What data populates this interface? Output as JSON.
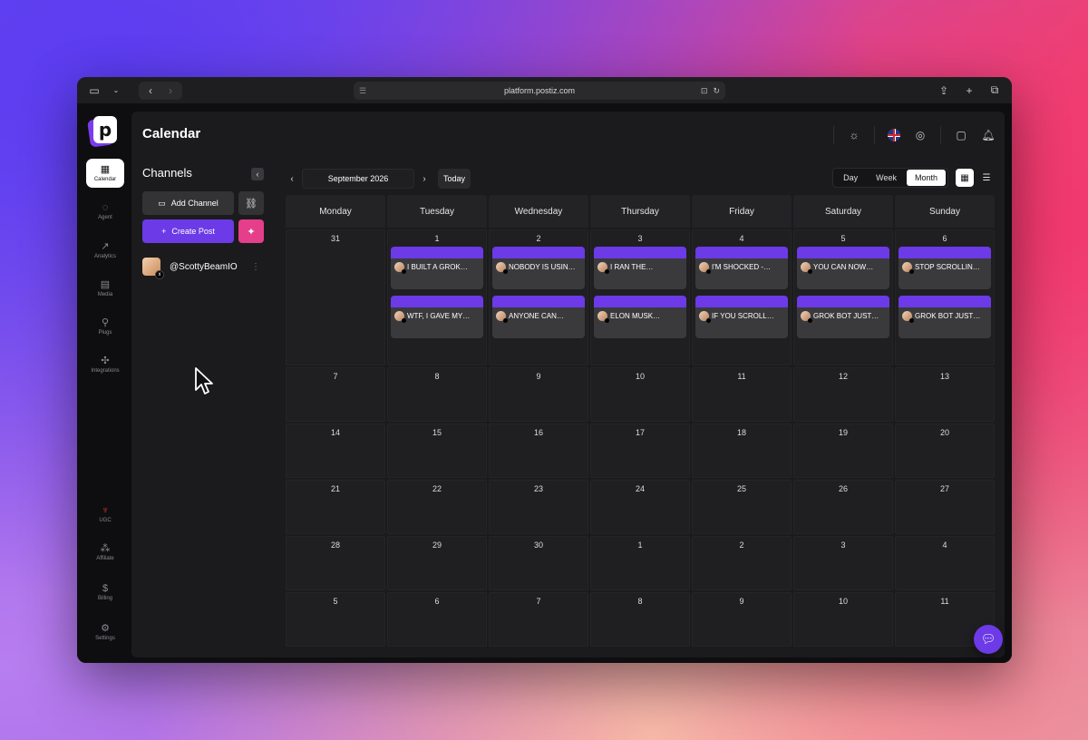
{
  "browser": {
    "url": "platform.postiz.com"
  },
  "app": {
    "page_title": "Calendar",
    "logo_letter": "p"
  },
  "rail": {
    "items": [
      {
        "label": "Calendar",
        "icon": "calendar-icon"
      },
      {
        "label": "Agent",
        "icon": "chat-icon"
      },
      {
        "label": "Analytics",
        "icon": "chart-icon"
      },
      {
        "label": "Media",
        "icon": "media-icon"
      },
      {
        "label": "Plugs",
        "icon": "plug-icon"
      },
      {
        "label": "Integrations",
        "icon": "puzzle-icon"
      },
      {
        "label": "UGC",
        "icon": "ugc-icon"
      },
      {
        "label": "Affiliate",
        "icon": "affiliate-icon"
      },
      {
        "label": "Billing",
        "icon": "billing-icon"
      },
      {
        "label": "Settings",
        "icon": "gear-icon"
      }
    ]
  },
  "channels": {
    "title": "Channels",
    "add_channel_label": "Add Channel",
    "create_post_label": "Create Post",
    "accounts": [
      {
        "name": "@ScottyBeamIO",
        "platform": "x"
      }
    ]
  },
  "calendar": {
    "current_month": "September 2026",
    "today_label": "Today",
    "views": [
      "Day",
      "Week",
      "Month"
    ],
    "active_view": "Month",
    "day_headers": [
      "Monday",
      "Tuesday",
      "Wednesday",
      "Thursday",
      "Friday",
      "Saturday",
      "Sunday"
    ],
    "weeks": [
      [
        "31",
        "1",
        "2",
        "3",
        "4",
        "5",
        "6"
      ],
      [
        "7",
        "8",
        "9",
        "10",
        "11",
        "12",
        "13"
      ],
      [
        "14",
        "15",
        "16",
        "17",
        "18",
        "19",
        "20"
      ],
      [
        "21",
        "22",
        "23",
        "24",
        "25",
        "26",
        "27"
      ],
      [
        "28",
        "29",
        "30",
        "1",
        "2",
        "3",
        "4"
      ],
      [
        "5",
        "6",
        "7",
        "8",
        "9",
        "10",
        "11"
      ]
    ],
    "posts": {
      "tuesday": [
        "I BUILT A GROK…",
        "WTF, I GAVE MY…"
      ],
      "wednesday": [
        "NOBODY IS USIN…",
        "ANYONE CAN…"
      ],
      "thursday": [
        "I RAN THE…",
        "ELON MUSK…"
      ],
      "friday": [
        "I'M SHOCKED -…",
        "IF YOU SCROLL…"
      ],
      "saturday": [
        "YOU CAN NOW…",
        "GROK BOT JUST…"
      ],
      "sunday": [
        "STOP SCROLLIN…",
        "GROK BOT JUST…"
      ]
    }
  },
  "colors": {
    "accent": "#6c3ae6",
    "magic": "#e53e8a"
  }
}
